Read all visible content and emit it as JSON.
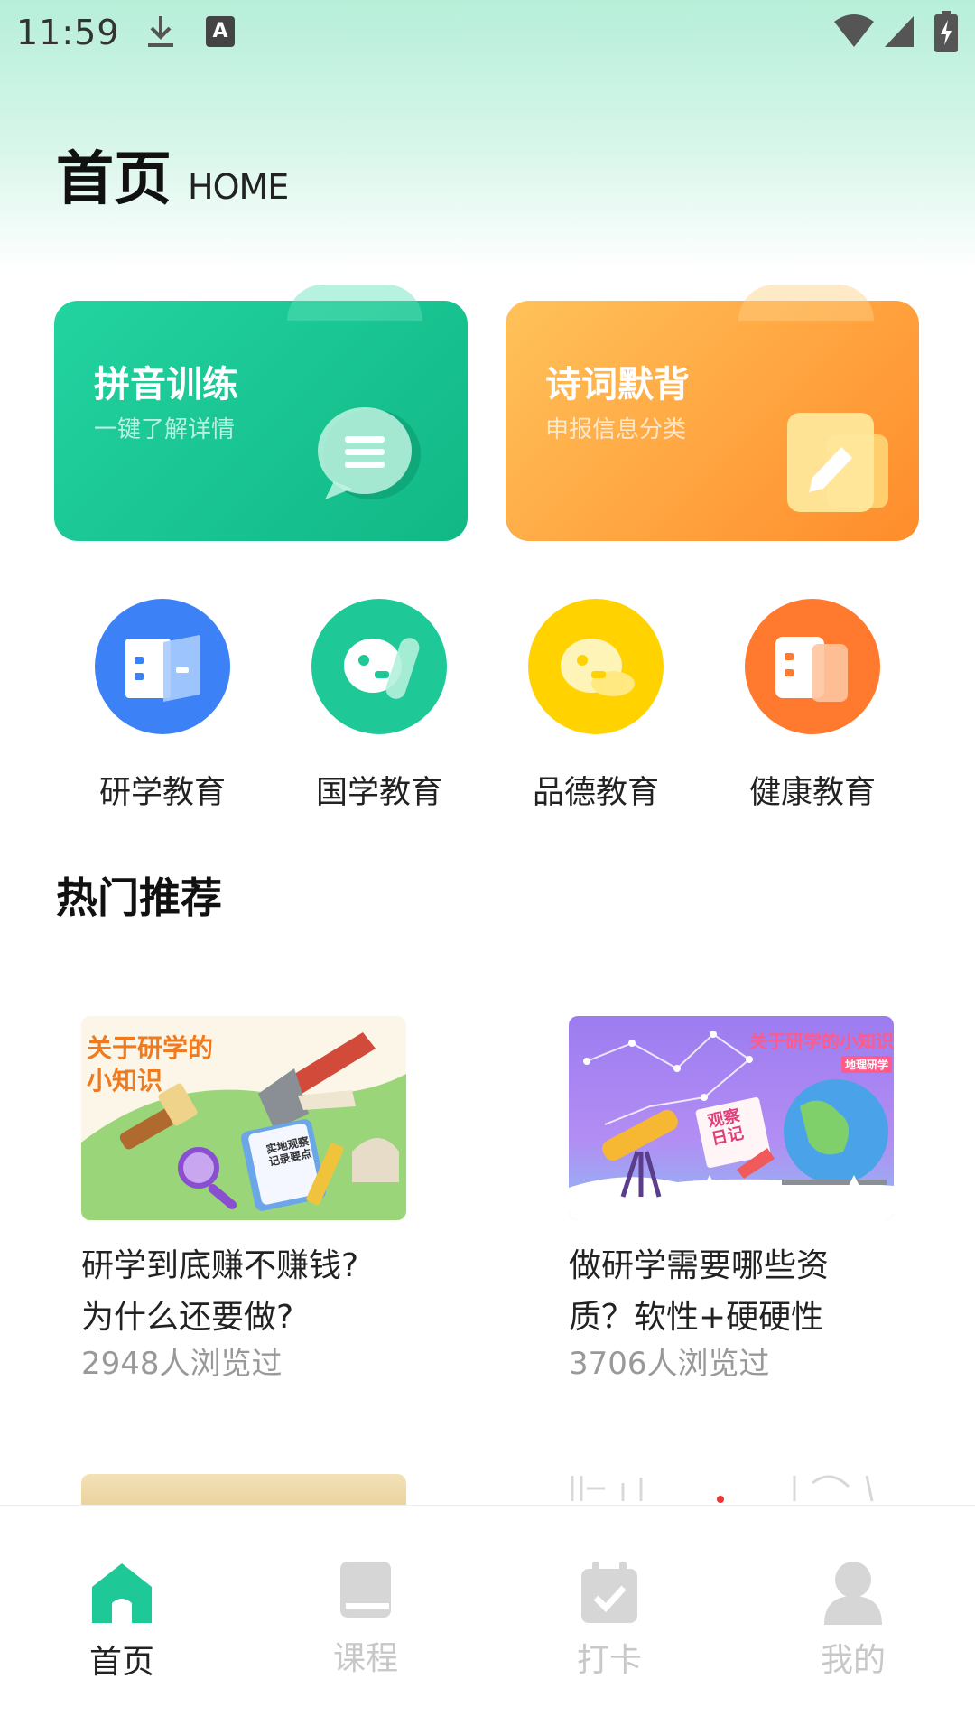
{
  "status_bar": {
    "time": "11:59",
    "ai_badge": "A"
  },
  "header": {
    "title_cn": "首页",
    "title_en": "HOME"
  },
  "feature_cards": [
    {
      "title": "拼音训练",
      "subtitle": "一键了解详情",
      "icon": "chat-bubble-icon",
      "color": "#1ec897"
    },
    {
      "title": "诗词默背",
      "subtitle": "申报信息分类",
      "icon": "pencil-note-icon",
      "color": "#ff9d38"
    }
  ],
  "categories": [
    {
      "label": "研学教育",
      "color": "#3c82f6",
      "icon": "book-icon"
    },
    {
      "label": "国学教育",
      "color": "#1ec897",
      "icon": "chat-icon"
    },
    {
      "label": "品德教育",
      "color": "#ffd200",
      "icon": "message-icon"
    },
    {
      "label": "健康教育",
      "color": "#ff7a2e",
      "icon": "document-icon"
    }
  ],
  "section": {
    "hot_title": "热门推荐"
  },
  "articles": [
    {
      "image_text_1": "关于研学的",
      "image_text_2": "小知识",
      "book_text_1": "实地观察",
      "book_text_2": "记录要点",
      "title_line1": "研学到底赚不赚钱?",
      "title_line2": "为什么还要做?",
      "views": "2948人浏览过"
    },
    {
      "image_text_1": "关于研学的小知识",
      "image_badge": "地理研学",
      "sign_text_1": "观察",
      "sign_text_2": "日记",
      "title_line1": "做研学需要哪些资",
      "title_line2": "质？软性+硬硬性",
      "views": "3706人浏览过"
    }
  ],
  "bottom_nav": [
    {
      "label": "首页",
      "icon": "home-icon",
      "active": true
    },
    {
      "label": "课程",
      "icon": "book-icon",
      "active": false
    },
    {
      "label": "打卡",
      "icon": "calendar-check-icon",
      "active": false
    },
    {
      "label": "我的",
      "icon": "user-icon",
      "active": false
    }
  ],
  "colors": {
    "accent": "#1ec897",
    "inactive": "#c8c8c8"
  }
}
